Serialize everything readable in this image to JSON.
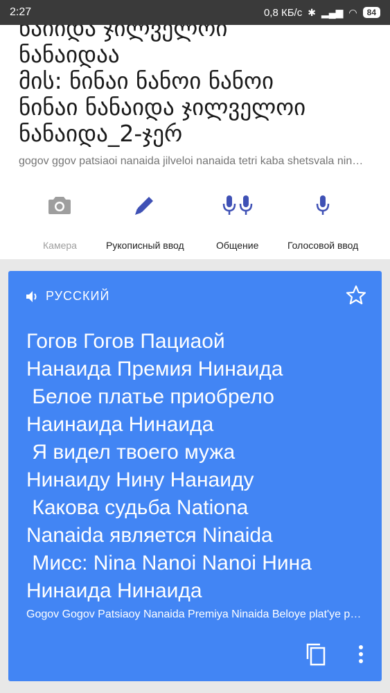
{
  "status_bar": {
    "time": "2:27",
    "speed": "0,8 КБ/с",
    "battery": "84"
  },
  "source": {
    "lines": [
      "ნაიიდა ჯილველოი",
      "ნანაიდაა",
      "მის: ნინაი ნანოი ნანოი",
      "ნინაი ნანაიდა ჯილველოი",
      "ნანაიდა_2-ჯერ"
    ],
    "transliteration": "gogov ggov patsiaoi nanaida jilveloi nanaida   tetri kaba shetsvala ninaida"
  },
  "tools": [
    {
      "label": "Камера",
      "icon": "camera-icon"
    },
    {
      "label": "Рукописный ввод",
      "icon": "pen-icon"
    },
    {
      "label": "Общение",
      "icon": "dual-mic-icon"
    },
    {
      "label": "Голосовой ввод",
      "icon": "mic-icon"
    }
  ],
  "result": {
    "language": "РУССКИЙ",
    "translation": "Гогов Гогов Пациаой\nНанаида Премия Нинаида\n Белое платье приобрело\nНаинаида Нинаида\n Я видел твоего мужа\nНинаиду Нину Нанаиду\n Какова судьба Nationa\nNanaida является Ninaida\n Мисс: Nina Nanoi Nanoi Нина\nНинаида Нинаида",
    "transliteration": "Gogov Gogov Patsiaoy Nanaida Premiya Ninaida Beloye plat'ye priobrelo"
  },
  "colors": {
    "accent": "#4285f4",
    "tool_icon": "#3f51b5",
    "disabled_icon": "#9e9e9e"
  }
}
